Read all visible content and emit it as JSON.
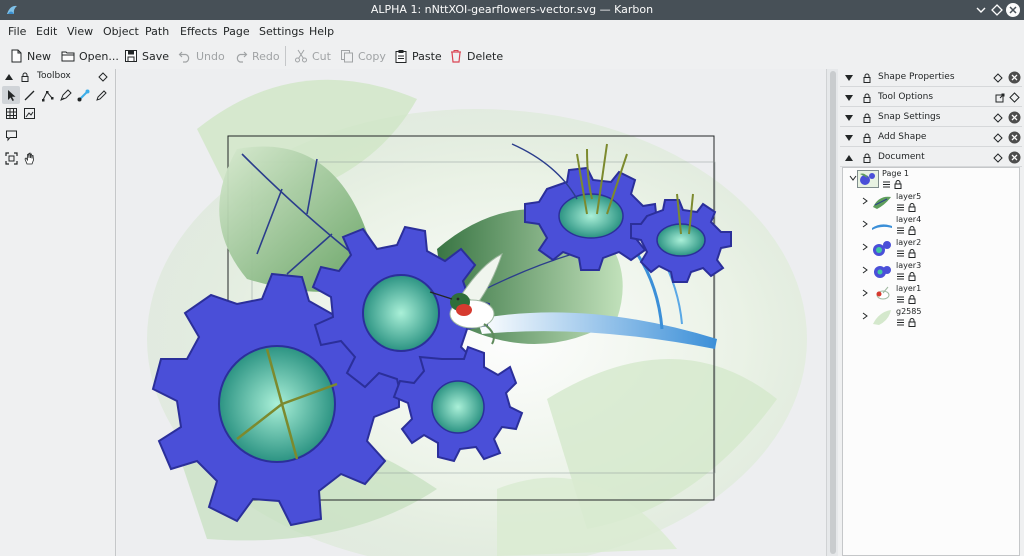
{
  "window": {
    "title": "ALPHA 1: nNttXOI-gearflowers-vector.svg — Karbon"
  },
  "menu": [
    "File",
    "Edit",
    "View",
    "Object",
    "Path",
    "Effects",
    "Page",
    "Settings",
    "Help"
  ],
  "toolbar": {
    "new": "New",
    "open": "Open...",
    "save": "Save",
    "undo": "Undo",
    "redo": "Redo",
    "cut": "Cut",
    "copy": "Copy",
    "paste": "Paste",
    "delete": "Delete"
  },
  "toolbox": {
    "title": "Toolbox"
  },
  "dockers": {
    "shape_properties": "Shape Properties",
    "tool_options": "Tool Options",
    "snap_settings": "Snap Settings",
    "add_shape": "Add Shape",
    "document": "Document"
  },
  "layers": {
    "page": "Page 1",
    "items": [
      "layer5",
      "layer4",
      "layer2",
      "layer3",
      "layer1",
      "g2585"
    ]
  },
  "colors": {
    "titlebar": "#475057",
    "gear_blue": "#4a4fd8",
    "leaf_green": "#3d8a4a",
    "delete_red": "#da4453"
  }
}
